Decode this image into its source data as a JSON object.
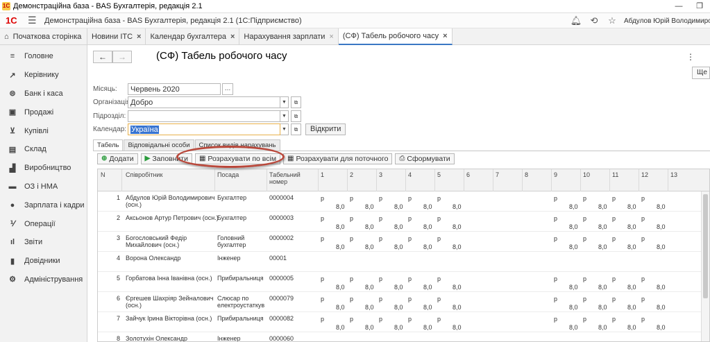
{
  "window": {
    "title": "Демонстраційна база - BAS Бухгалтерія, редакція 2.1",
    "btn_min": "—",
    "btn_max": "❐"
  },
  "header": {
    "logo": "1С",
    "app_title": "Демонстраційна база - BAS Бухгалтерія, редакція 2.1  (1С:Підприємство)",
    "user": "Абдулов Юрій Володимирович"
  },
  "tabs": [
    {
      "label": "Початкова сторінка"
    },
    {
      "label": "Новини ІТС"
    },
    {
      "label": "Календар бухгалтера"
    },
    {
      "label": "Нарахування зарплати"
    },
    {
      "label": "(СФ) Табель робочого часу"
    }
  ],
  "sidebar": {
    "items": [
      {
        "label": "Головне",
        "icon": "menu-icon"
      },
      {
        "label": "Керівнику",
        "icon": "trend-icon"
      },
      {
        "label": "Банк і каса",
        "icon": "bank-icon"
      },
      {
        "label": "Продажі",
        "icon": "bag-icon"
      },
      {
        "label": "Купівлі",
        "icon": "cart-icon"
      },
      {
        "label": "Склад",
        "icon": "warehouse-icon"
      },
      {
        "label": "Виробництво",
        "icon": "factory-icon"
      },
      {
        "label": "ОЗ і НМА",
        "icon": "truck-icon"
      },
      {
        "label": "Зарплата і кадри",
        "icon": "person-icon"
      },
      {
        "label": "Операції",
        "icon": "operations-icon"
      },
      {
        "label": "Звіти",
        "icon": "chart-icon"
      },
      {
        "label": "Довідники",
        "icon": "book-icon"
      },
      {
        "label": "Адміністрування",
        "icon": "gear-icon"
      }
    ]
  },
  "doc": {
    "title": "(СФ) Табель робочого часу",
    "more_label": "Ще",
    "month_label": "Місяць:",
    "month_value": "Червень 2020",
    "org_label": "Організація:",
    "org_value": "Добро",
    "div_label": "Підрозділ:",
    "div_value": "",
    "cal_label": "Календар:",
    "cal_value": "Україна",
    "open_btn": "Відкрити"
  },
  "form_tabs": [
    "Табель",
    "Відповідальні особи",
    "Список видів нарахувань"
  ],
  "commands": {
    "add": "Додати",
    "fill": "Заповнити",
    "calc_all": "Розрахувати по всім",
    "calc_current": "Розрахувати для поточного",
    "generate": "Сформувати"
  },
  "table": {
    "headers": {
      "n": "N",
      "employee": "Співробітник",
      "position": "Посада",
      "tab_no_1": "Табельний",
      "tab_no_2": "номер"
    },
    "day_headers": [
      "1",
      "2",
      "3",
      "4",
      "5",
      "6",
      "7",
      "8",
      "9",
      "10",
      "11",
      "12",
      "13"
    ],
    "rows": [
      {
        "n": "1",
        "name1": "Абдулов Юрій Володимирович",
        "name2": "(осн.)",
        "pos1": "Бухгалтер",
        "pos2": "",
        "tab": "0000004",
        "top": [
          "р",
          "р",
          "р",
          "р",
          "р",
          "",
          "",
          "",
          "р",
          "р",
          "р",
          "р",
          ""
        ],
        "bottom": [
          "8,0",
          "8,0",
          "8,0",
          "8,0",
          "8,0",
          "",
          "",
          "",
          "8,0",
          "8,0",
          "8,0",
          "8,0",
          ""
        ]
      },
      {
        "n": "2",
        "name1": "Аксьонов Артур Петрович (осн.)",
        "name2": "",
        "pos1": "Бухгалтер",
        "pos2": "",
        "tab": "0000003",
        "top": [
          "р",
          "р",
          "р",
          "р",
          "р",
          "",
          "",
          "",
          "р",
          "р",
          "р",
          "р",
          ""
        ],
        "bottom": [
          "8,0",
          "8,0",
          "8,0",
          "8,0",
          "8,0",
          "",
          "",
          "",
          "8,0",
          "8,0",
          "8,0",
          "8,0",
          ""
        ]
      },
      {
        "n": "3",
        "name1": "Богословський Федір",
        "name2": "Михайлович (осн.)",
        "pos1": "Головний",
        "pos2": "бухгалтер",
        "tab": "0000002",
        "top": [
          "р",
          "р",
          "р",
          "р",
          "р",
          "",
          "",
          "",
          "р",
          "р",
          "р",
          "р",
          ""
        ],
        "bottom": [
          "8,0",
          "8,0",
          "8,0",
          "8,0",
          "8,0",
          "",
          "",
          "",
          "8,0",
          "8,0",
          "8,0",
          "8,0",
          ""
        ]
      },
      {
        "n": "4",
        "name1": "Ворона Олександр",
        "name2": "",
        "pos1": "Інженер",
        "pos2": "",
        "tab": "00001",
        "top": [
          "",
          "",
          "",
          "",
          "",
          "",
          "",
          "",
          "",
          "",
          "",
          "",
          ""
        ],
        "bottom": [
          "",
          "",
          "",
          "",
          "",
          "",
          "",
          "",
          "",
          "",
          "",
          "",
          ""
        ]
      },
      {
        "n": "5",
        "name1": "Горбатова Інна Іванівна (осн.)",
        "name2": "",
        "pos1": "Прибиральниця",
        "pos2": "",
        "tab": "0000005",
        "top": [
          "р",
          "р",
          "р",
          "р",
          "р",
          "",
          "",
          "",
          "р",
          "р",
          "р",
          "р",
          ""
        ],
        "bottom": [
          "8,0",
          "8,0",
          "8,0",
          "8,0",
          "8,0",
          "",
          "",
          "",
          "8,0",
          "8,0",
          "8,0",
          "8,0",
          ""
        ]
      },
      {
        "n": "6",
        "name1": "Єргешев Шахріяр Зейналович",
        "name2": "(осн.)",
        "pos1": "Слюсар по",
        "pos2": "електроустаткув",
        "tab": "0000079",
        "top": [
          "р",
          "р",
          "р",
          "р",
          "р",
          "",
          "",
          "",
          "р",
          "р",
          "р",
          "р",
          ""
        ],
        "bottom": [
          "8,0",
          "8,0",
          "8,0",
          "8,0",
          "8,0",
          "",
          "",
          "",
          "8,0",
          "8,0",
          "8,0",
          "8,0",
          ""
        ]
      },
      {
        "n": "7",
        "name1": "Зайчук Ірина Вікторівна (осн.)",
        "name2": "",
        "pos1": "Прибиральниця",
        "pos2": "",
        "tab": "0000082",
        "top": [
          "р",
          "р",
          "р",
          "р",
          "р",
          "",
          "",
          "",
          "р",
          "р",
          "р",
          "р",
          ""
        ],
        "bottom": [
          "8,0",
          "8,0",
          "8,0",
          "8,0",
          "8,0",
          "",
          "",
          "",
          "8,0",
          "8,0",
          "8,0",
          "8,0",
          ""
        ]
      },
      {
        "n": "8",
        "name1": "Золотухін Олександр",
        "name2": "",
        "pos1": "Інженер",
        "pos2": "",
        "tab": "0000060",
        "top": [
          "",
          "",
          "",
          "",
          "",
          "",
          "",
          "",
          "",
          "",
          "",
          "",
          ""
        ],
        "bottom": [
          "",
          "",
          "",
          "",
          "",
          "",
          "",
          "",
          "",
          "",
          "",
          "",
          ""
        ]
      }
    ]
  }
}
